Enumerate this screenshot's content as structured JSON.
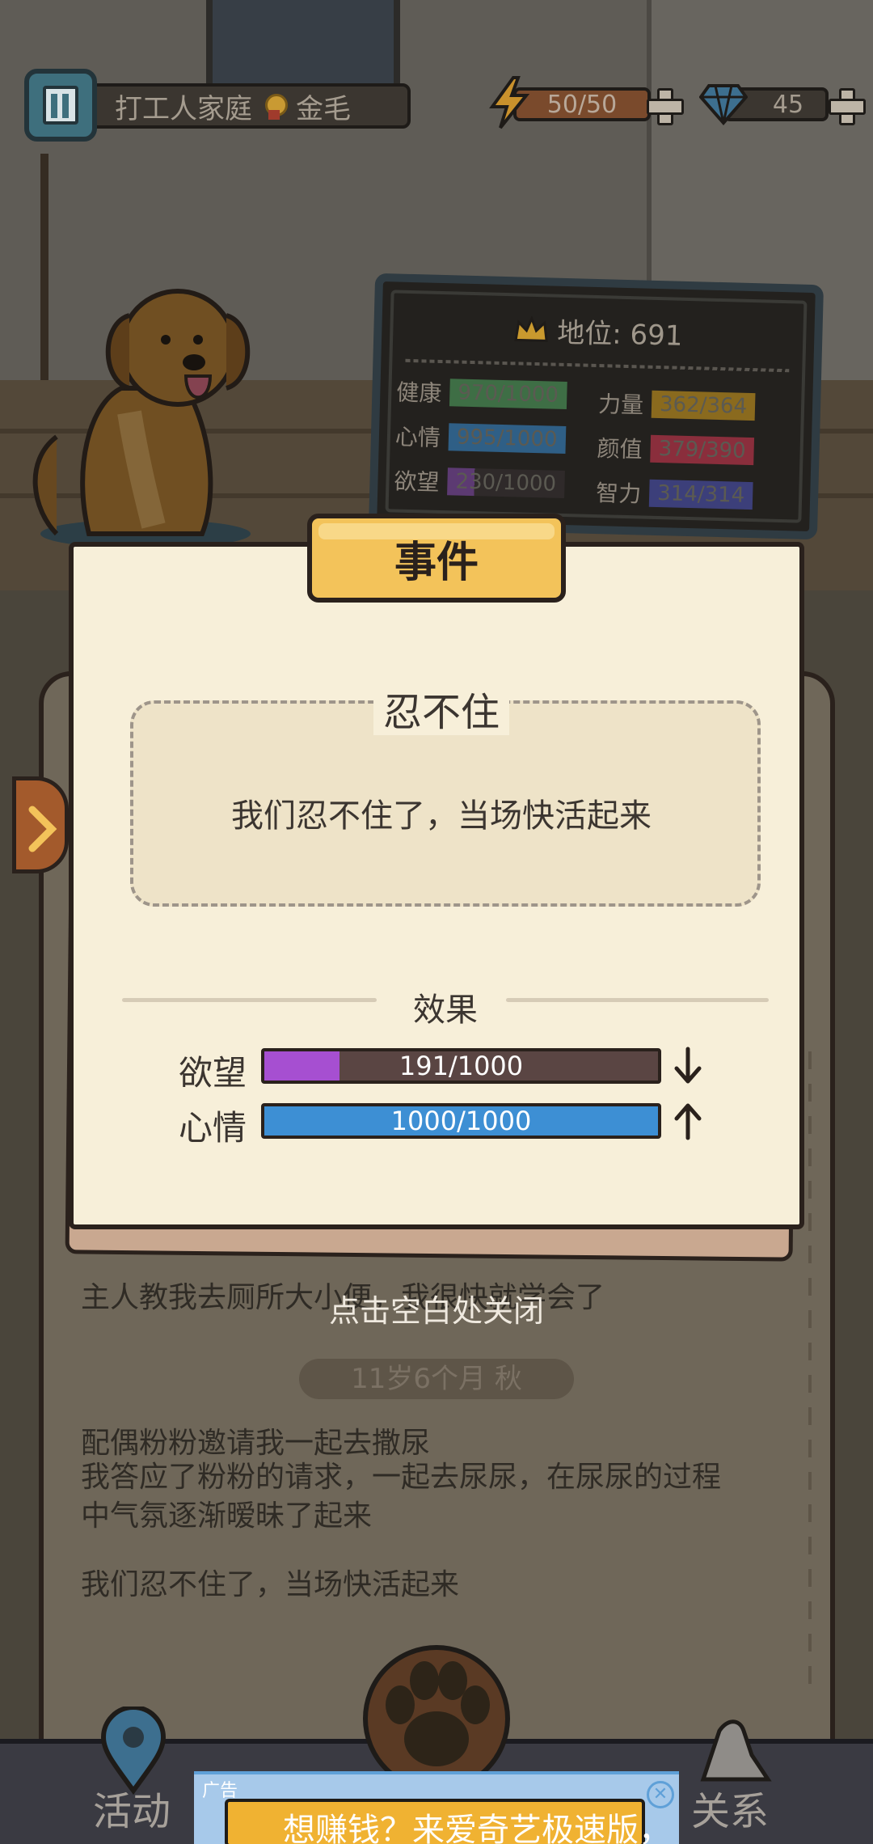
{
  "hud": {
    "family": "打工人家庭",
    "breed": "金毛",
    "energy": "50/50",
    "gems": "45"
  },
  "stats": {
    "status_label": "地位: 691",
    "items": [
      {
        "label": "健康",
        "value": "970/1000",
        "color": "#3e6e45"
      },
      {
        "label": "力量",
        "value": "362/364",
        "color": "#8a6a1e"
      },
      {
        "label": "心情",
        "value": "995/1000",
        "color": "#2f5f86"
      },
      {
        "label": "颜值",
        "value": "379/390",
        "color": "#8a2e3c"
      },
      {
        "label": "欲望",
        "value": "230/1000",
        "value_fill": 0.23,
        "color": "#5c3a72"
      },
      {
        "label": "智力",
        "value": "314/314",
        "color": "#3c3f7a"
      }
    ]
  },
  "event": {
    "banner": "事件",
    "title": "忍不住",
    "description": "我们忍不住了，当场快活起来",
    "effect_label": "效果",
    "effects": [
      {
        "name": "欲望",
        "value": "191/1000",
        "fill": 0.191,
        "color": "#a64fd1",
        "direction": "down"
      },
      {
        "name": "心情",
        "value": "1000/1000",
        "fill": 1.0,
        "color": "#3d8fd4",
        "direction": "up"
      }
    ]
  },
  "close_hint": "点击空白处关闭",
  "log": {
    "line1": "主人教我去厕所大小便，我很快就学会了",
    "date": "11岁6个月 秋",
    "line2": "配偶粉粉邀请我一起去撒尿",
    "line3": "我答应了粉粉的请求，一起去尿尿，在尿尿的过程",
    "line4": "中气氛逐渐暧昧了起来",
    "line5": "我们忍不住了，当场快活起来"
  },
  "nav": {
    "activity": "活动",
    "relation": "关系"
  },
  "ad": {
    "tag": "广告",
    "text": "想赚钱？来爱奇艺极速版，"
  }
}
